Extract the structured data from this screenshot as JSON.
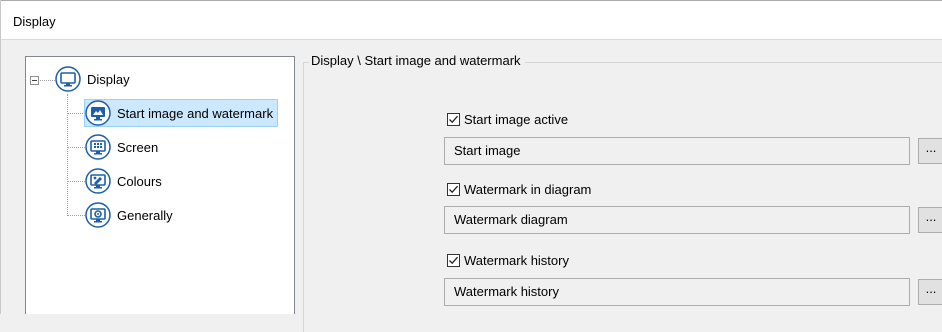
{
  "window": {
    "title": "Display"
  },
  "tree": {
    "root": {
      "label": "Display",
      "icon": "monitor-icon"
    },
    "items": [
      {
        "label": "Start image and watermark",
        "icon": "monitor-image-icon",
        "selected": true
      },
      {
        "label": "Screen",
        "icon": "monitor-screen-icon",
        "selected": false
      },
      {
        "label": "Colours",
        "icon": "monitor-colours-icon",
        "selected": false
      },
      {
        "label": "Generally",
        "icon": "monitor-gear-icon",
        "selected": false
      }
    ]
  },
  "panel": {
    "caption": "Display \\ Start image and watermark",
    "options": [
      {
        "checkbox_label": "Start image active",
        "checked": true,
        "field_value": "Start image",
        "browse_label": "..."
      },
      {
        "checkbox_label": "Watermark in diagram",
        "checked": true,
        "field_value": "Watermark diagram",
        "browse_label": "..."
      },
      {
        "checkbox_label": "Watermark history",
        "checked": true,
        "field_value": "Watermark history",
        "browse_label": "..."
      }
    ]
  },
  "colors": {
    "icon_blue": "#1d5fa8",
    "selection_bg": "#cce8ff",
    "selection_border": "#99d1ff"
  }
}
